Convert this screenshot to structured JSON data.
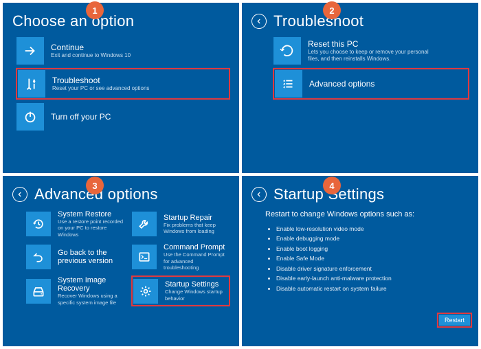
{
  "badges": [
    "1",
    "2",
    "3",
    "4"
  ],
  "panel1": {
    "title": "Choose an option",
    "tiles": [
      {
        "title": "Continue",
        "sub": "Exit and continue to Windows 10"
      },
      {
        "title": "Troubleshoot",
        "sub": "Reset your PC or see advanced options"
      },
      {
        "title": "Turn off your PC",
        "sub": ""
      }
    ]
  },
  "panel2": {
    "title": "Troubleshoot",
    "tiles": [
      {
        "title": "Reset this PC",
        "sub": "Lets you choose to keep or remove your personal files, and then reinstalls Windows."
      },
      {
        "title": "Advanced options",
        "sub": ""
      }
    ]
  },
  "panel3": {
    "title": "Advanced options",
    "tiles": [
      {
        "title": "System Restore",
        "sub": "Use a restore point recorded on your PC to restore Windows"
      },
      {
        "title": "Startup Repair",
        "sub": "Fix problems that keep Windows from loading"
      },
      {
        "title": "Go back to the previous version",
        "sub": ""
      },
      {
        "title": "Command Prompt",
        "sub": "Use the Command Prompt for advanced troubleshooting"
      },
      {
        "title": "System Image Recovery",
        "sub": "Recover Windows using a specific system image file"
      },
      {
        "title": "Startup Settings",
        "sub": "Change Windows startup behavior"
      }
    ]
  },
  "panel4": {
    "title": "Startup Settings",
    "subtitle": "Restart to change Windows options such as:",
    "items": [
      "Enable low-resolution video mode",
      "Enable debugging mode",
      "Enable boot logging",
      "Enable Safe Mode",
      "Disable driver signature enforcement",
      "Disable early-launch anti-malware protection",
      "Disable automatic restart on system failure"
    ],
    "restart": "Restart"
  }
}
